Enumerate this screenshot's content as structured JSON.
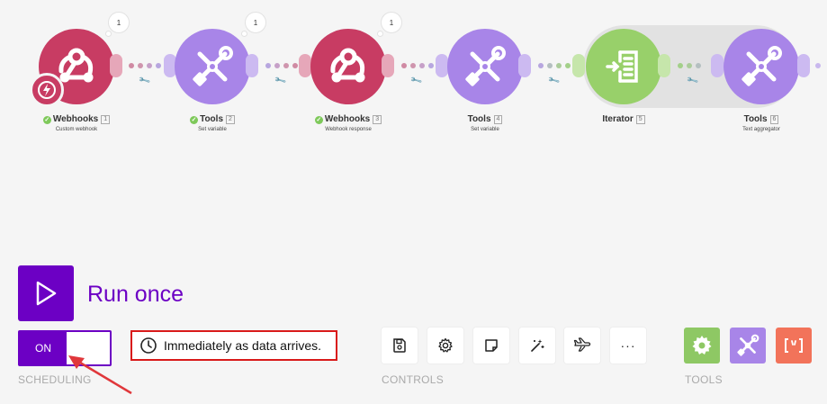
{
  "modules": [
    {
      "name": "Webhooks",
      "index": "1",
      "subtitle": "Custom webhook",
      "ops": "1",
      "checked": true
    },
    {
      "name": "Tools",
      "index": "2",
      "subtitle": "Set variable",
      "ops": "1",
      "checked": true
    },
    {
      "name": "Webhooks",
      "index": "3",
      "subtitle": "Webhook response",
      "ops": "1",
      "checked": true
    },
    {
      "name": "Tools",
      "index": "4",
      "subtitle": "Set variable",
      "checked": false
    },
    {
      "name": "Iterator",
      "index": "5",
      "subtitle": "",
      "checked": false
    },
    {
      "name": "Tools",
      "index": "6",
      "subtitle": "Text aggregator",
      "checked": false
    }
  ],
  "run": {
    "label": "Run once"
  },
  "scheduling": {
    "toggle_label": "ON",
    "caption": "SCHEDULING",
    "schedule_text": "Immediately as data arrives."
  },
  "controls": {
    "caption": "CONTROLS",
    "more_label": "···"
  },
  "tools": {
    "caption": "TOOLS"
  },
  "colors": {
    "brand_purple": "#6c00c4",
    "webhook": "#c83c63",
    "tools": "#a885e8",
    "iterator": "#98d06a",
    "highlight": "#d91a1a",
    "json_tool": "#f2735a"
  }
}
